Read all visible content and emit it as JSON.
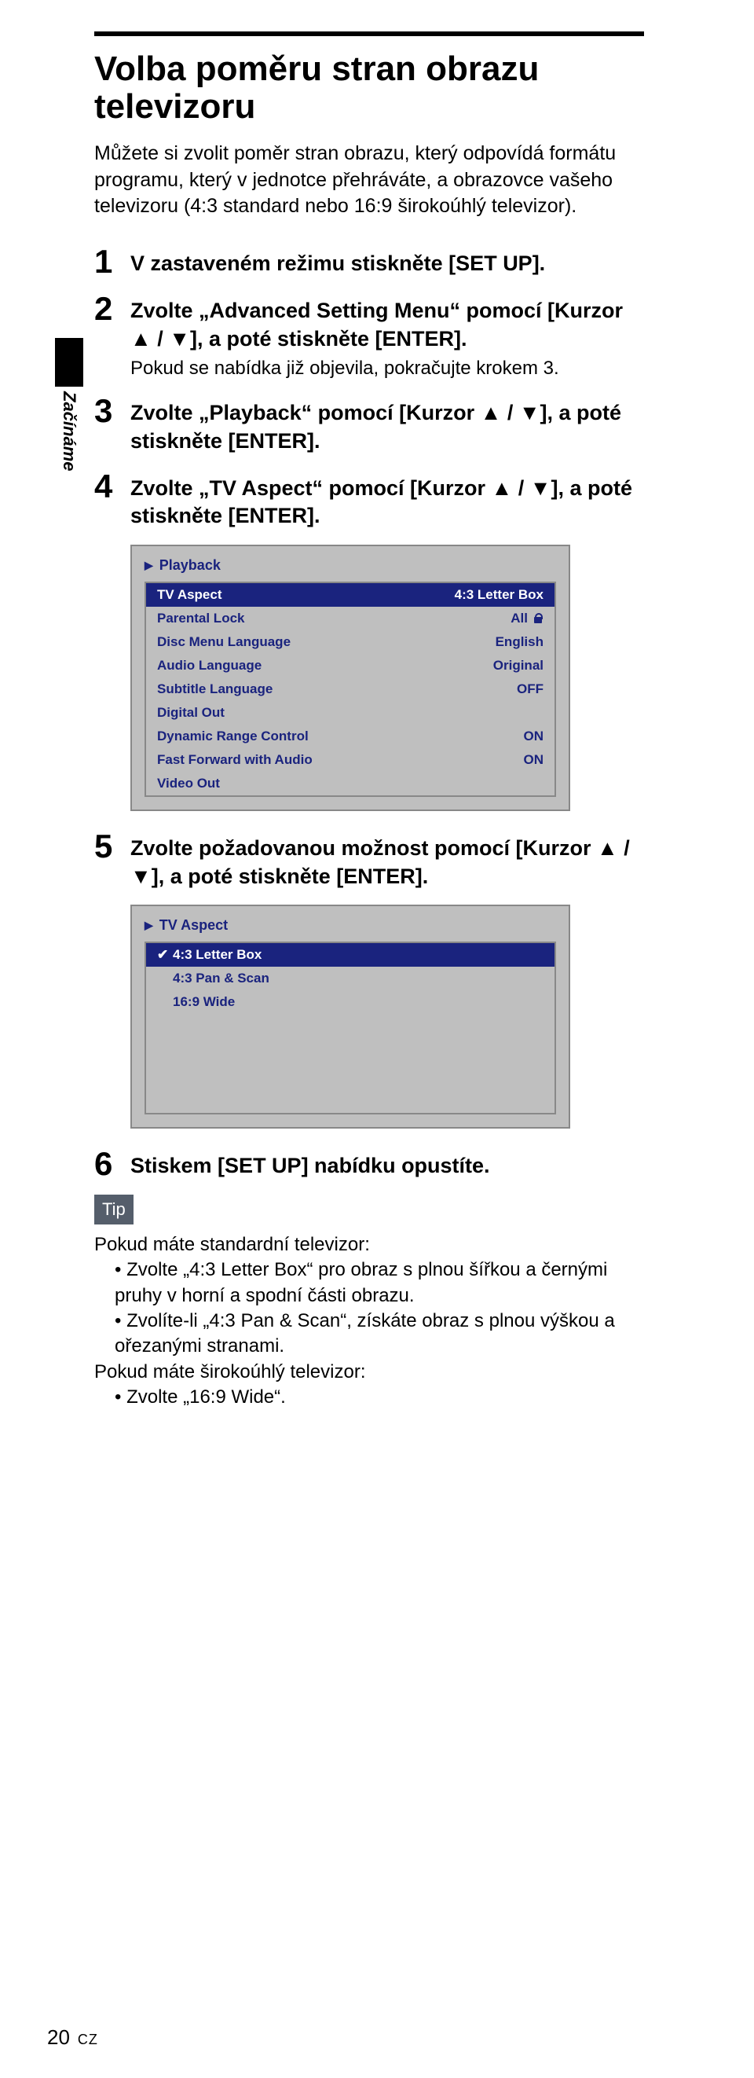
{
  "sideTab": "Začínáme",
  "title": "Volba poměru stran obrazu televizoru",
  "intro": "Můžete si zvolit poměr stran obrazu, který odpovídá formátu programu, který v jednotce přehráváte, a obrazovce vašeho televizoru (4:3 standard nebo 16:9 širokoúhlý televizor).",
  "steps": {
    "s1": {
      "num": "1",
      "text": "V zastaveném režimu stiskněte [SET UP]."
    },
    "s2": {
      "num": "2",
      "text": "Zvolte „Advanced Setting Menu“ pomocí [Kurzor ▲ / ▼], a poté stiskněte [ENTER].",
      "note": "Pokud se nabídka již objevila, pokračujte krokem 3."
    },
    "s3": {
      "num": "3",
      "text": "Zvolte „Playback“ pomocí [Kurzor ▲ / ▼], a poté stiskněte [ENTER]."
    },
    "s4": {
      "num": "4",
      "text": "Zvolte „TV Aspect“ pomocí [Kurzor ▲ / ▼], a poté stiskněte [ENTER]."
    },
    "s5": {
      "num": "5",
      "text": "Zvolte požadovanou možnost pomocí [Kurzor ▲ / ▼], a poté stiskněte [ENTER]."
    },
    "s6": {
      "num": "6",
      "text": "Stiskem [SET UP] nabídku opustíte."
    }
  },
  "menu1": {
    "title": "Playback",
    "rows": {
      "r0": {
        "l": "TV Aspect",
        "r": "4:3 Letter Box"
      },
      "r1": {
        "l": "Parental Lock",
        "r": "All"
      },
      "r2": {
        "l": "Disc Menu Language",
        "r": "English"
      },
      "r3": {
        "l": "Audio Language",
        "r": "Original"
      },
      "r4": {
        "l": "Subtitle Language",
        "r": "OFF"
      },
      "r5": {
        "l": "Digital Out",
        "r": ""
      },
      "r6": {
        "l": "Dynamic Range Control",
        "r": "ON"
      },
      "r7": {
        "l": "Fast Forward with Audio",
        "r": "ON"
      },
      "r8": {
        "l": "Video Out",
        "r": ""
      }
    }
  },
  "menu2": {
    "title": "TV Aspect",
    "opt0": "4:3 Letter Box",
    "opt1": "4:3 Pan & Scan",
    "opt2": "16:9 Wide"
  },
  "tip": {
    "badge": "Tip",
    "line1": "Pokud máte standardní televizor:",
    "b1": "Zvolte „4:3 Letter Box“ pro obraz s plnou šířkou a černými pruhy v horní a spodní části obrazu.",
    "b2": "Zvolíte-li „4:3 Pan & Scan“, získáte obraz s plnou výškou a ořezanými stranami.",
    "line2": "Pokud máte širokoúhlý televizor:",
    "b3": "Zvolte „16:9 Wide“."
  },
  "footer": {
    "page": "20",
    "lang": "CZ"
  }
}
